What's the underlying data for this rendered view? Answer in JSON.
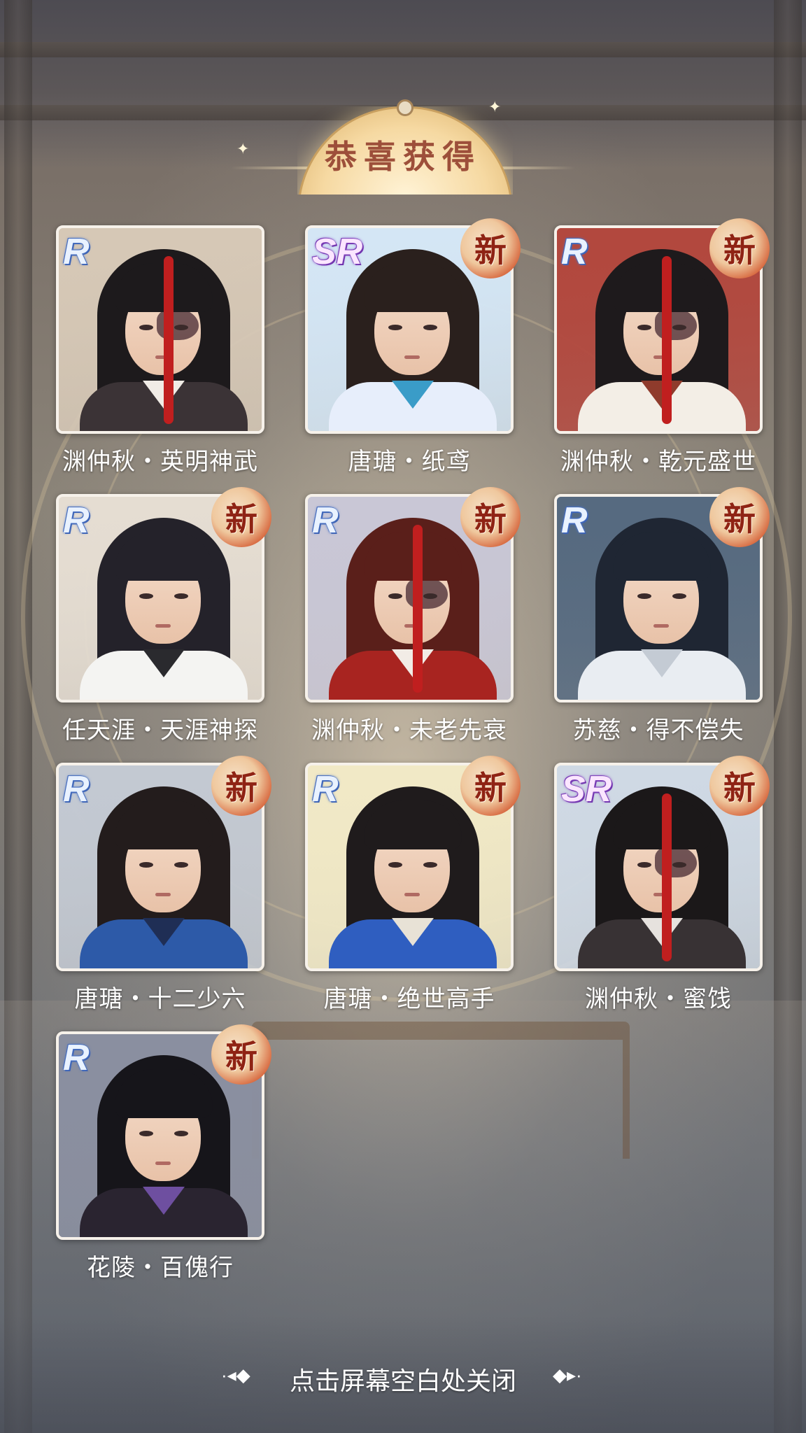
{
  "title": "恭喜获得",
  "close_hint": "点击屏幕空白处关闭",
  "new_label": "新",
  "cards": [
    {
      "name": "渊仲秋・英明神武",
      "rarity": "R",
      "is_new": false,
      "hair": "#1d1a1c",
      "robe": "#3b3336",
      "collar": "#f1ece6",
      "bg": "#d6c8b6",
      "red_streak": true,
      "mask": true
    },
    {
      "name": "唐瑭・纸鸢",
      "rarity": "SR",
      "is_new": true,
      "hair": "#2a201d",
      "robe": "#e7eefb",
      "collar": "#3a9cc8",
      "bg": "#d4e6f5",
      "red_streak": false,
      "mask": false
    },
    {
      "name": "渊仲秋・乾元盛世",
      "rarity": "R",
      "is_new": true,
      "hair": "#1e1a1c",
      "robe": "#f3eee6",
      "collar": "#8f3b2c",
      "bg": "#b2483e",
      "red_streak": true,
      "mask": true
    },
    {
      "name": "任天涯・天涯神探",
      "rarity": "R",
      "is_new": true,
      "hair": "#24222a",
      "robe": "#f4f4f2",
      "collar": "#2a2a2e",
      "bg": "#e5ddd2",
      "red_streak": false,
      "mask": false
    },
    {
      "name": "渊仲秋・未老先衰",
      "rarity": "R",
      "is_new": true,
      "hair": "#5a1f1a",
      "robe": "#a82420",
      "collar": "#f2ece6",
      "bg": "#c9c7d6",
      "red_streak": true,
      "mask": true
    },
    {
      "name": "苏慈・得不偿失",
      "rarity": "R",
      "is_new": true,
      "hair": "#1f2633",
      "robe": "#e9edf2",
      "collar": "#c4cbd4",
      "bg": "#566a80",
      "red_streak": false,
      "mask": false
    },
    {
      "name": "唐瑭・十二少六",
      "rarity": "R",
      "is_new": true,
      "hair": "#231c1c",
      "robe": "#2d5aa8",
      "collar": "#1f2e55",
      "bg": "#c3c9d2",
      "red_streak": false,
      "mask": false
    },
    {
      "name": "唐瑭・绝世高手",
      "rarity": "R",
      "is_new": true,
      "hair": "#1f1b1c",
      "robe": "#2f5ec0",
      "collar": "#e8e2d6",
      "bg": "#f1e9c6",
      "red_streak": false,
      "mask": false
    },
    {
      "name": "渊仲秋・蜜饯",
      "rarity": "SR",
      "is_new": true,
      "hair": "#1b1819",
      "robe": "#383234",
      "collar": "#e6e2de",
      "bg": "#cfd9e4",
      "red_streak": true,
      "mask": true
    },
    {
      "name": "花陵・百傀行",
      "rarity": "R",
      "is_new": true,
      "hair": "#16151a",
      "robe": "#2a2430",
      "collar": "#6e4fa0",
      "bg": "#8a8fa0",
      "red_streak": false,
      "mask": false
    }
  ]
}
